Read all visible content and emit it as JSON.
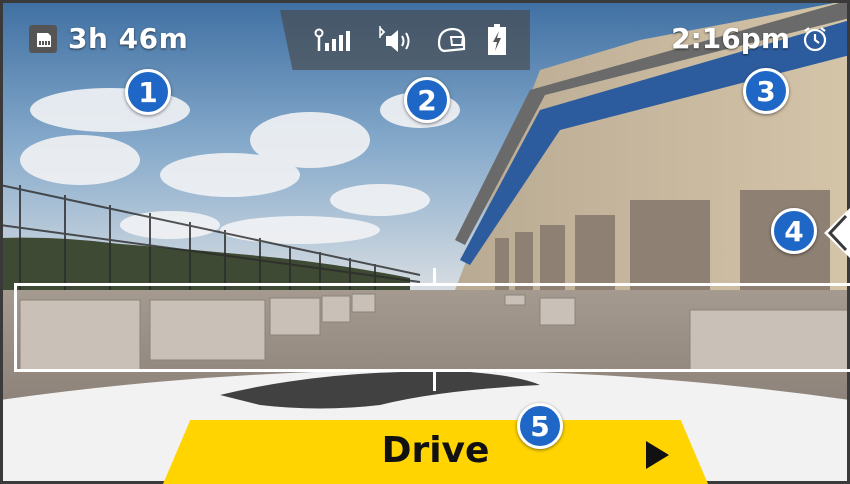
{
  "status": {
    "recording_time": "3h 46m",
    "clock_time": "2:16pm",
    "icons": [
      "sd-card-icon",
      "cellular-signal-icon",
      "bluetooth-audio-icon",
      "helmet-icon",
      "battery-charging-icon",
      "alarm-clock-icon"
    ]
  },
  "callouts": [
    "1",
    "2",
    "3",
    "4",
    "5"
  ],
  "bottom_bar": {
    "label": "Drive",
    "arrow_icon": "play-arrow-icon",
    "color": "#ffd400"
  },
  "colors": {
    "callout": "#1e67c6",
    "status_panel": "#464646"
  }
}
